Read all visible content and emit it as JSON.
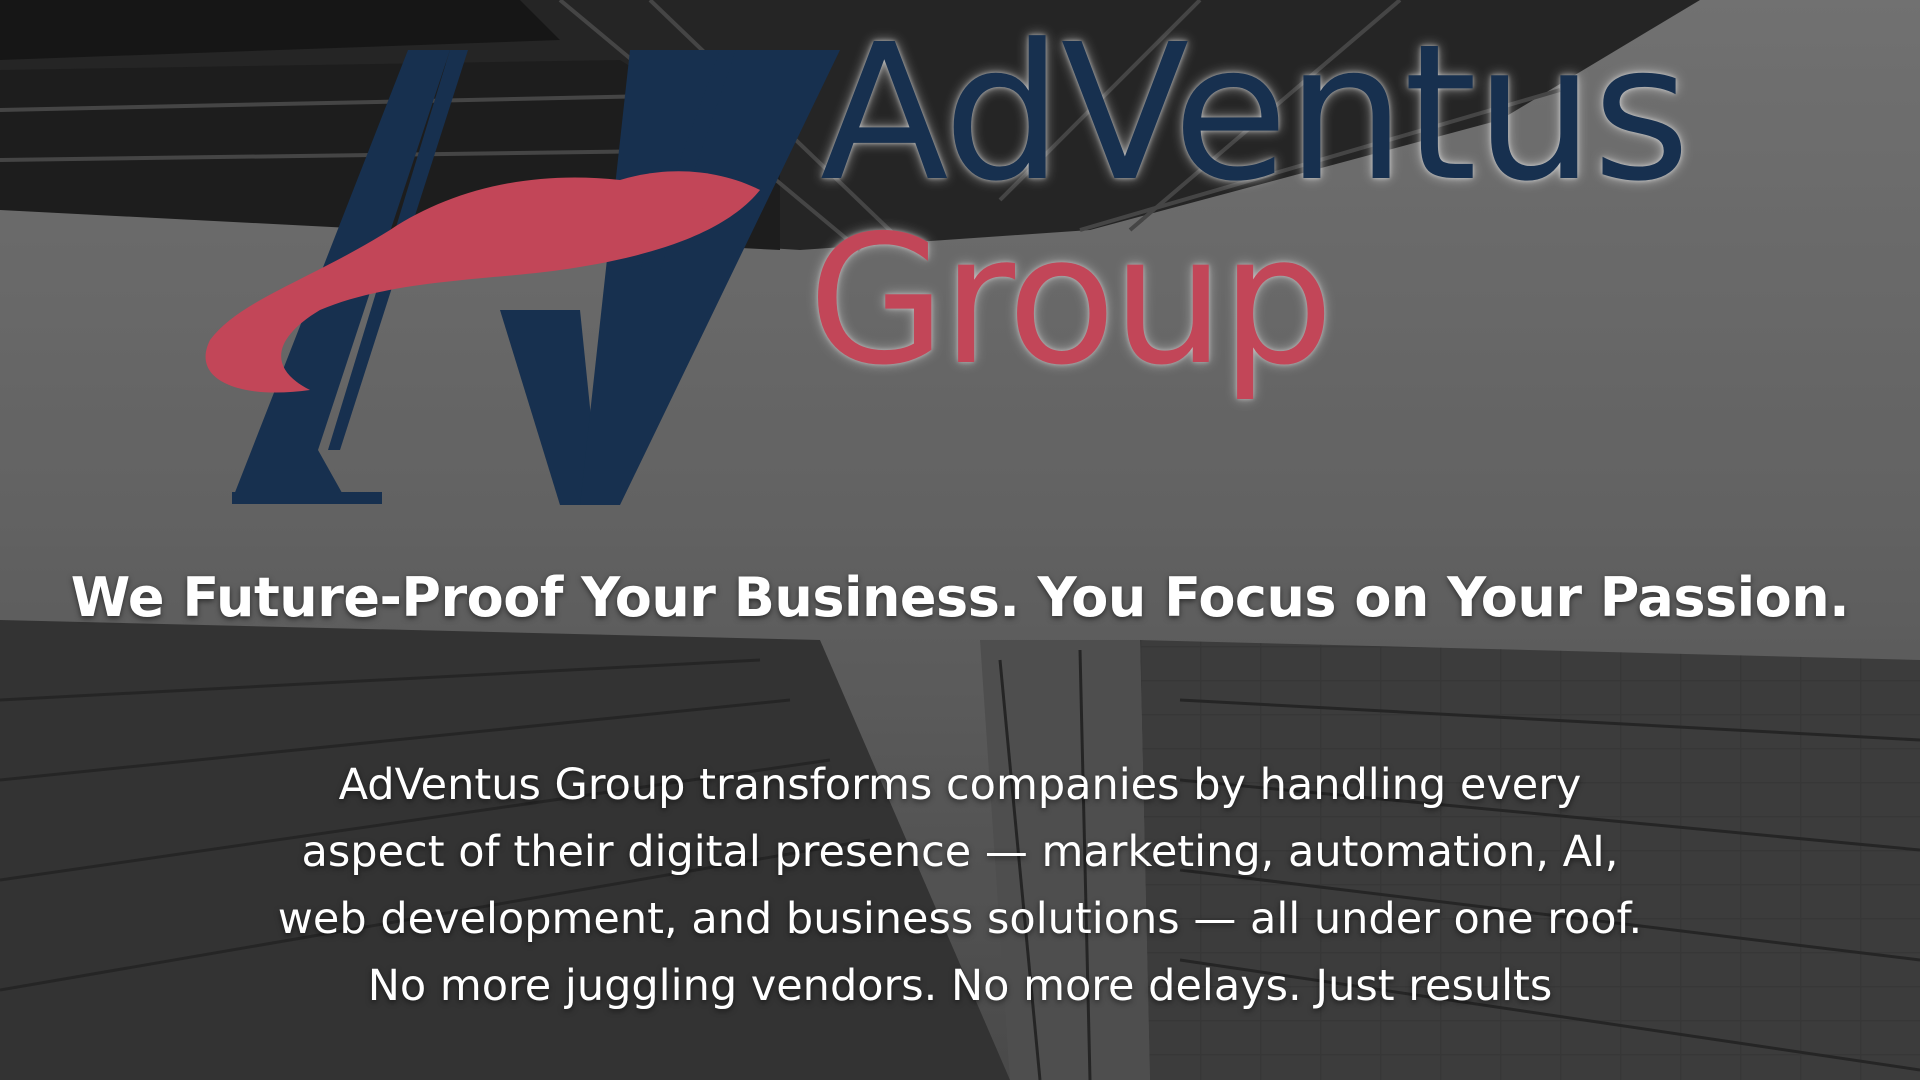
{
  "brand": {
    "name_line1": "AdVentus",
    "name_line2": "Group"
  },
  "headline": "We Future-Proof Your Business. You Focus on Your Passion.",
  "description_lines": [
    "AdVentus Group transforms companies by handling every",
    "aspect of their digital presence — marketing, automation, AI,",
    "web development, and business solutions — all under one roof.",
    "No more juggling vendors. No more delays. Just results"
  ],
  "colors": {
    "brand_navy": "#17304f",
    "brand_red": "#c24658",
    "text_white": "#ffffff",
    "background_gray": "#6f6f6f"
  },
  "icons": {
    "logo_mark": "av-monogram-logo-icon",
    "background": "building-facade-photo"
  }
}
